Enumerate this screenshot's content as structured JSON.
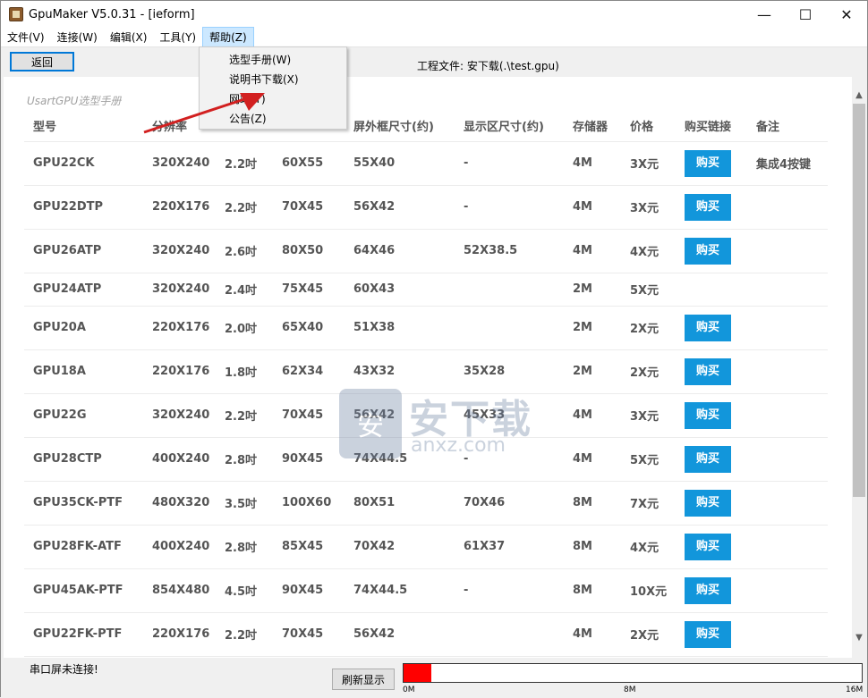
{
  "window": {
    "title": "GpuMaker V5.0.31 - [ieform]"
  },
  "menu": [
    "文件(V)",
    "连接(W)",
    "编辑(X)",
    "工具(Y)",
    "帮助(Z)"
  ],
  "help_menu_items": [
    "选型手册(W)",
    "说明书下载(X)",
    "网站(Y)",
    "公告(Z)"
  ],
  "toolbar": {
    "back_label": "返回",
    "project_label": "工程文件: 安下载(.\\test.gpu)"
  },
  "manual_title": "UsartGPU选型手册",
  "table": {
    "headers": [
      "型号",
      "分辨率",
      "",
      "",
      "屏外框尺寸(约)",
      "显示区尺寸(约)",
      "存储器",
      "价格",
      "购买链接",
      "备注"
    ],
    "rows": [
      {
        "model": "GPU22CK",
        "res": "320X240",
        "size": "2.2吋",
        "outline": "60X55",
        "frame": "55X40",
        "display": "-",
        "mem": "4M",
        "price": "3X元",
        "buy": "购买",
        "note": "集成4按键"
      },
      {
        "model": "GPU22DTP",
        "res": "220X176",
        "size": "2.2吋",
        "outline": "70X45",
        "frame": "56X42",
        "display": "-",
        "mem": "4M",
        "price": "3X元",
        "buy": "购买",
        "note": ""
      },
      {
        "model": "GPU26ATP",
        "res": "320X240",
        "size": "2.6吋",
        "outline": "80X50",
        "frame": "64X46",
        "display": "52X38.5",
        "mem": "4M",
        "price": "4X元",
        "buy": "购买",
        "note": ""
      },
      {
        "model": "GPU24ATP",
        "res": "320X240",
        "size": "2.4吋",
        "outline": "75X45",
        "frame": "60X43",
        "display": "",
        "mem": "2M",
        "price": "5X元",
        "buy": "",
        "note": ""
      },
      {
        "model": "GPU20A",
        "res": "220X176",
        "size": "2.0吋",
        "outline": "65X40",
        "frame": "51X38",
        "display": "",
        "mem": "2M",
        "price": "2X元",
        "buy": "购买",
        "note": ""
      },
      {
        "model": "GPU18A",
        "res": "220X176",
        "size": "1.8吋",
        "outline": "62X34",
        "frame": "43X32",
        "display": "35X28",
        "mem": "2M",
        "price": "2X元",
        "buy": "购买",
        "note": ""
      },
      {
        "model": "GPU22G",
        "res": "320X240",
        "size": "2.2吋",
        "outline": "70X45",
        "frame": "56X42",
        "display": "45X33",
        "mem": "4M",
        "price": "3X元",
        "buy": "购买",
        "note": ""
      },
      {
        "model": "GPU28CTP",
        "res": "400X240",
        "size": "2.8吋",
        "outline": "90X45",
        "frame": "74X44.5",
        "display": "-",
        "mem": "4M",
        "price": "5X元",
        "buy": "购买",
        "note": ""
      },
      {
        "model": "GPU35CK-PTF",
        "res": "480X320",
        "size": "3.5吋",
        "outline": "100X60",
        "frame": "80X51",
        "display": "70X46",
        "mem": "8M",
        "price": "7X元",
        "buy": "购买",
        "note": ""
      },
      {
        "model": "GPU28FK-ATF",
        "res": "400X240",
        "size": "2.8吋",
        "outline": "85X45",
        "frame": "70X42",
        "display": "61X37",
        "mem": "8M",
        "price": "4X元",
        "buy": "购买",
        "note": ""
      },
      {
        "model": "GPU45AK-PTF",
        "res": "854X480",
        "size": "4.5吋",
        "outline": "90X45",
        "frame": "74X44.5",
        "display": "-",
        "mem": "8M",
        "price": "10X元",
        "buy": "购买",
        "note": ""
      },
      {
        "model": "GPU22FK-PTF",
        "res": "220X176",
        "size": "2.2吋",
        "outline": "70X45",
        "frame": "56X42",
        "display": "",
        "mem": "4M",
        "price": "2X元",
        "buy": "购买",
        "note": ""
      }
    ]
  },
  "status": {
    "text": "串口屏未连接!",
    "refresh_label": "刷新显示",
    "progress_fraction": 0.06,
    "progress_color": "#ff0000",
    "ticks": [
      "0M",
      "8M",
      "16M"
    ]
  },
  "watermark": {
    "badge": "安",
    "cn": "安下载",
    "en": "anxz.com"
  }
}
